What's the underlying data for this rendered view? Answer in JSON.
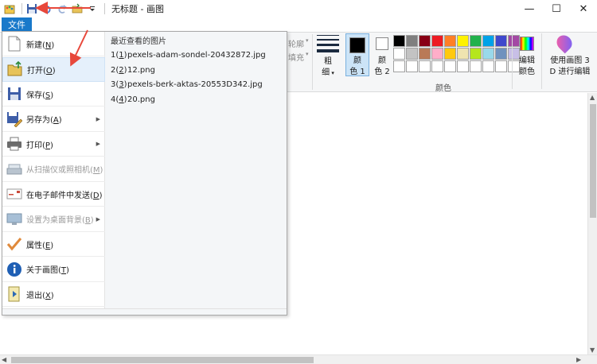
{
  "titlebar": {
    "title": "无标题 - 画图",
    "minimize": "—",
    "maximize": "☐",
    "close": "✕"
  },
  "ribbon": {
    "file_tab": "文件",
    "outline_label": "轮廓",
    "fill_label": "填充",
    "thickness_label_top": "粗",
    "thickness_label_bottom": "细",
    "color1_top": "颜",
    "color1_bottom": "色 1",
    "color2_top": "颜",
    "color2_bottom": "色 2",
    "colors_group": "颜色",
    "edit_colors_top": "编辑",
    "edit_colors_bottom": "颜色",
    "paint3d_top": "使用画图 3",
    "paint3d_bottom": "D 进行编辑",
    "palette": [
      "#000000",
      "#7f7f7f",
      "#880015",
      "#ed1c24",
      "#ff7f27",
      "#fff200",
      "#22b14c",
      "#00a2e8",
      "#3f48cc",
      "#a349a4",
      "#ffffff",
      "#c3c3c3",
      "#b97a57",
      "#ffaec9",
      "#ffc90e",
      "#efe4b0",
      "#b5e61d",
      "#99d9ea",
      "#7092be",
      "#c8bfe7",
      "#ffffff",
      "#ffffff",
      "#ffffff",
      "#ffffff",
      "#ffffff",
      "#ffffff",
      "#ffffff",
      "#ffffff",
      "#ffffff",
      "#ffffff"
    ]
  },
  "file_menu": {
    "items": [
      {
        "label": "新建",
        "key": "N",
        "icon": "new-file-icon"
      },
      {
        "label": "打开",
        "key": "O",
        "icon": "open-folder-icon"
      },
      {
        "label": "保存",
        "key": "S",
        "icon": "save-icon"
      },
      {
        "label": "另存为",
        "key": "A",
        "icon": "save-as-icon"
      },
      {
        "label": "打印",
        "key": "P",
        "icon": "print-icon"
      },
      {
        "label": "从扫描仪或照相机",
        "key": "M",
        "icon": "scanner-icon"
      },
      {
        "label": "在电子邮件中发送",
        "key": "D",
        "icon": "email-icon"
      },
      {
        "label": "设置为桌面背景",
        "key": "B",
        "icon": "desktop-background-icon"
      },
      {
        "label": "属性",
        "key": "E",
        "icon": "properties-checkmark-icon"
      },
      {
        "label": "关于画图",
        "key": "T",
        "icon": "info-icon"
      },
      {
        "label": "退出",
        "key": "X",
        "icon": "exit-icon"
      }
    ],
    "recent_title": "最近查看的图片",
    "recent": [
      {
        "num": "1",
        "name": "pexels-adam-sondel-20432872.jpg"
      },
      {
        "num": "2",
        "name": "12.png"
      },
      {
        "num": "3",
        "name": "pexels-berk-aktas-20553D342.jpg"
      },
      {
        "num": "4",
        "name": "20.png"
      }
    ]
  },
  "colors": {
    "accent": "#1979ca",
    "annotation_arrow": "#e8483b"
  }
}
